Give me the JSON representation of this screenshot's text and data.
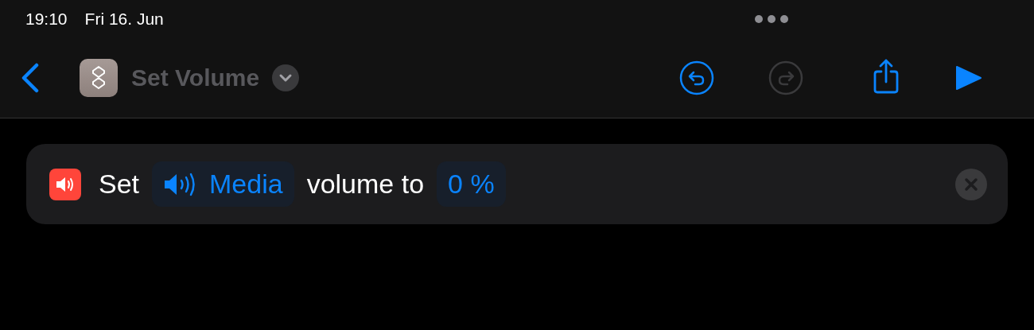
{
  "status_bar": {
    "time": "19:10",
    "date": "Fri 16. Jun"
  },
  "nav_bar": {
    "title": "Set Volume",
    "toolbar": [
      {
        "kind": "undo",
        "disabled": false
      },
      {
        "kind": "redo",
        "disabled": true
      },
      {
        "kind": "share",
        "disabled": false
      },
      {
        "kind": "run",
        "disabled": false
      }
    ]
  },
  "action": {
    "parts": [
      {
        "kind": "word",
        "text": "Set"
      },
      {
        "kind": "device-token",
        "text": "Media"
      },
      {
        "kind": "word",
        "text": "volume to"
      },
      {
        "kind": "value-token",
        "text": "0 %"
      }
    ]
  }
}
